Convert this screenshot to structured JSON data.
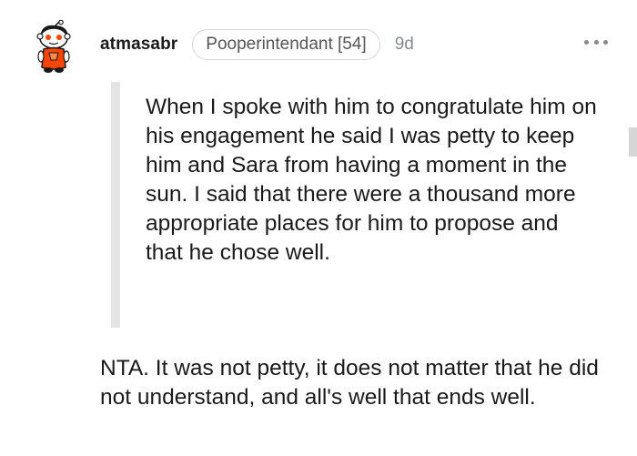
{
  "comment": {
    "author": "atmasabr",
    "flair": "Pooperintendant [54]",
    "age": "9d",
    "quote": "When I spoke with him to congratulate him on his engagement he said I was petty to keep him and Sara from having a moment in the sun. I said that there were a thousand more appropriate places for him to propose and that he chose well.",
    "body": "NTA. It was not petty, it does not matter that he did not understand, and all's well that ends well."
  },
  "icons": {
    "avatar": "snoo-avatar-icon",
    "more": "more-options-icon"
  },
  "colors": {
    "avatar_orange": "#ff4500",
    "meta_gray": "#878a8c",
    "quote_bar": "#e4e4e4"
  }
}
